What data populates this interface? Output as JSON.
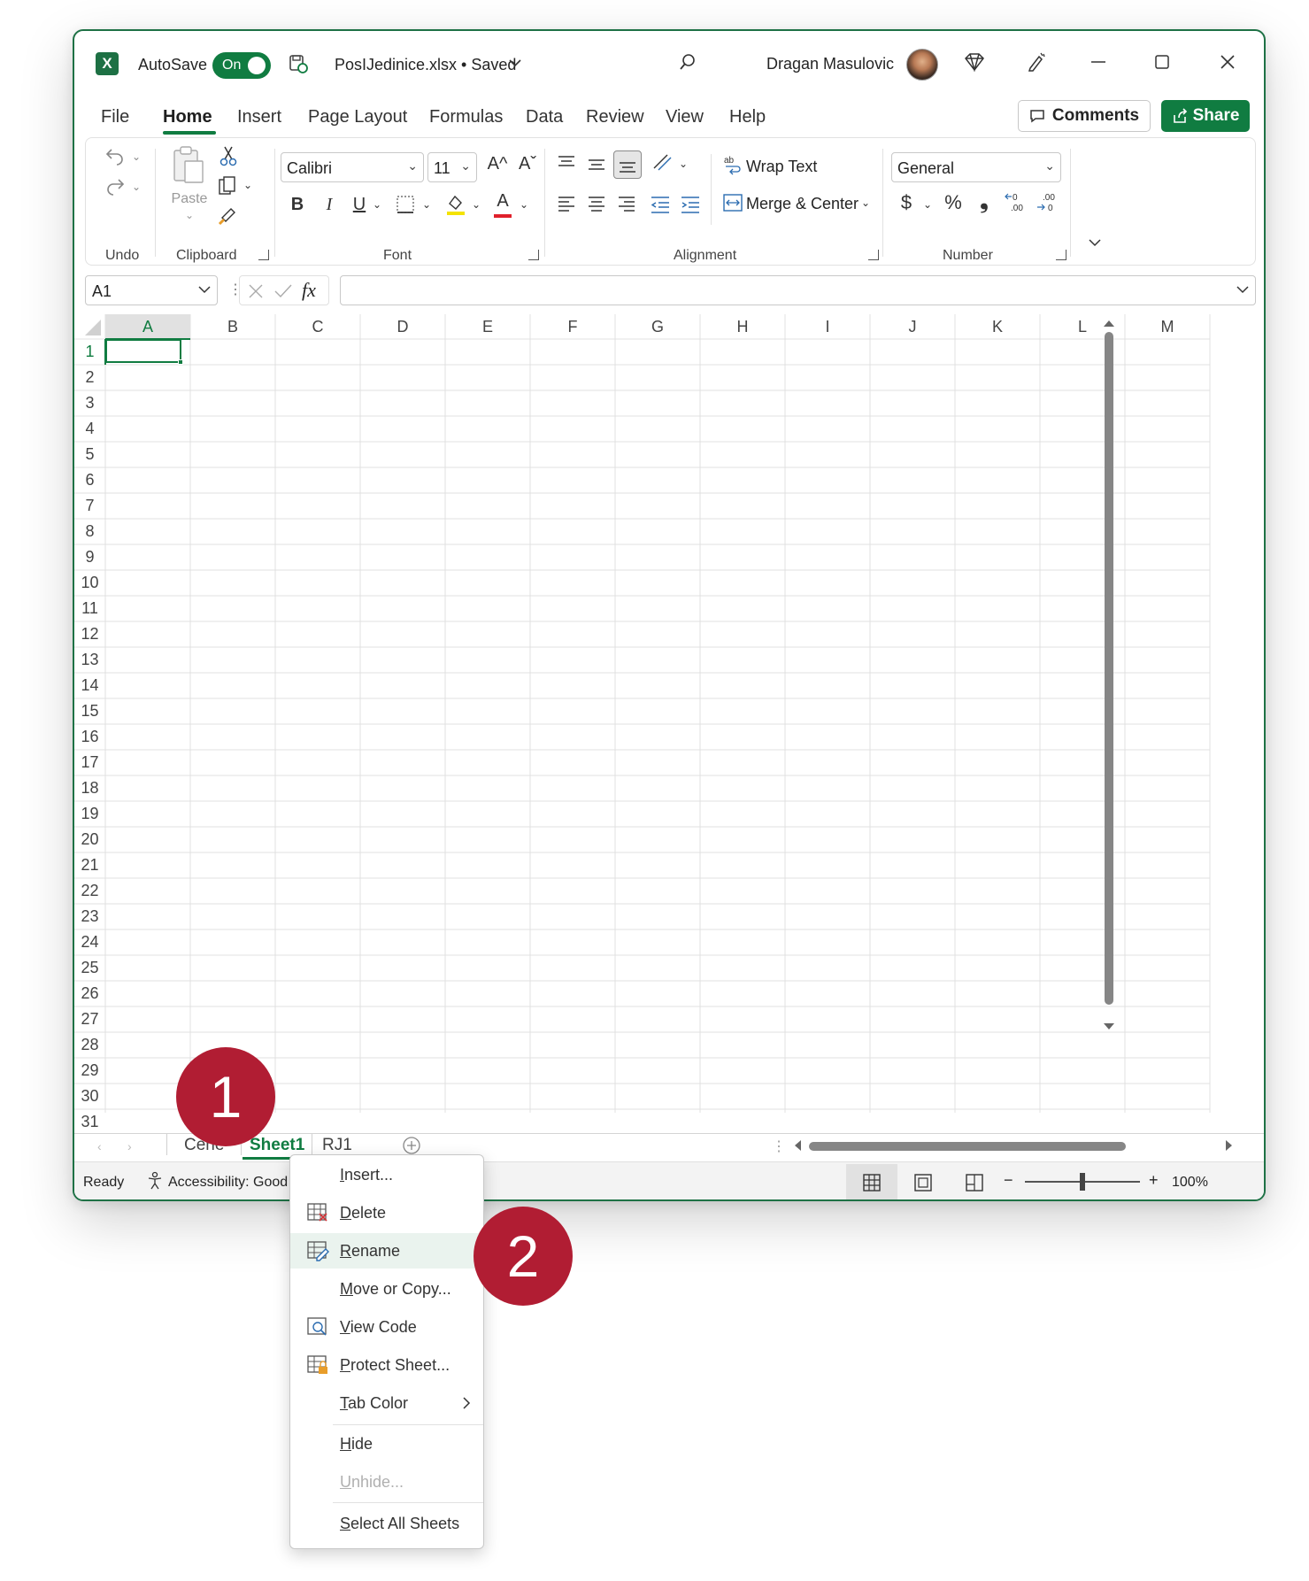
{
  "titlebar": {
    "autosave_label": "AutoSave",
    "toggle_label": "On",
    "filename": "PosIJedinice.xlsx • Saved",
    "user": "Dragan Masulovic"
  },
  "menu": {
    "items": [
      "File",
      "Home",
      "Insert",
      "Page Layout",
      "Formulas",
      "Data",
      "Review",
      "View",
      "Help"
    ],
    "comments": "Comments",
    "share": "Share"
  },
  "ribbon": {
    "undo_label": "Undo",
    "clipboard_label": "Clipboard",
    "paste_label": "Paste",
    "font_label": "Font",
    "font_name": "Calibri",
    "font_size": "11",
    "alignment_label": "Alignment",
    "wrap_text": "Wrap Text",
    "merge_center": "Merge & Center",
    "number_label": "Number",
    "number_format": "General",
    "bold": "B",
    "italic": "I",
    "underline": "U",
    "grow": "A^",
    "shrink": "Aˇ",
    "font_color": "A",
    "currency": "$",
    "percent": "%",
    "comma": "❟",
    "fx": "fx"
  },
  "formula_bar": {
    "name_box": "A1"
  },
  "grid": {
    "columns": [
      "A",
      "B",
      "C",
      "D",
      "E",
      "F",
      "G",
      "H",
      "I",
      "J",
      "K",
      "L",
      "M"
    ],
    "rows": [
      "1",
      "2",
      "3",
      "4",
      "5",
      "6",
      "7",
      "8",
      "9",
      "10",
      "11",
      "12",
      "13",
      "14",
      "15",
      "16",
      "17",
      "18",
      "19",
      "20",
      "21",
      "22",
      "23",
      "24",
      "25",
      "26",
      "27",
      "28",
      "29",
      "30",
      "31"
    ]
  },
  "sheets": {
    "tabs": [
      "Cene",
      "Sheet1",
      "RJ1"
    ],
    "active": "Sheet1"
  },
  "status": {
    "ready": "Ready",
    "accessibility": "Accessibility: Good t",
    "zoom": "100%",
    "zoom_level": 1.0
  },
  "context_menu": {
    "items": [
      {
        "accel": "I",
        "rest": "nsert..."
      },
      {
        "accel": "D",
        "rest": "elete"
      },
      {
        "accel": "R",
        "rest": "ename"
      },
      {
        "accel": "M",
        "rest": "ove or Copy..."
      },
      {
        "accel": "V",
        "rest": "iew Code"
      },
      {
        "accel": "P",
        "rest": "rotect Sheet..."
      },
      {
        "accel": "T",
        "rest": "ab Color"
      },
      {
        "accel": "H",
        "rest": "ide"
      },
      {
        "accel": "U",
        "rest": "nhide..."
      },
      {
        "accel": "S",
        "rest": "elect All Sheets"
      }
    ]
  },
  "badges": {
    "step1": "1",
    "step2": "2"
  },
  "colors": {
    "excel_green": "#107c41",
    "badge_red": "#b11d33",
    "highlight": "#eaf3ee"
  }
}
